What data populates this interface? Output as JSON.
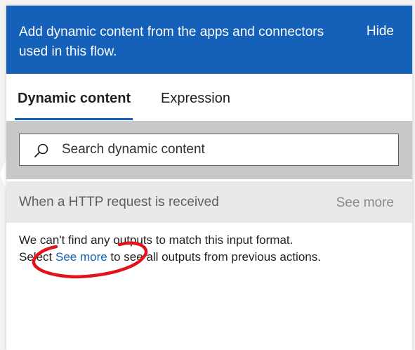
{
  "header": {
    "text": "Add dynamic content from the apps and connectors used in this flow.",
    "hide_label": "Hide"
  },
  "tabs": [
    {
      "label": "Dynamic content",
      "active": true
    },
    {
      "label": "Expression",
      "active": false
    }
  ],
  "search": {
    "placeholder": "Search dynamic content",
    "value": ""
  },
  "section": {
    "title": "When a HTTP request is received",
    "see_more_label": "See more"
  },
  "message": {
    "line1": "We can't find any outputs to match this input format.",
    "line2_before": "Select ",
    "line2_link": "See more",
    "line2_after": " to see all outputs from previous actions."
  },
  "colors": {
    "header_bg": "#1560b8",
    "accent": "#1560b8",
    "search_area_bg": "#c8c8c8",
    "section_bg": "#e9eae8",
    "annotation": "#e3131b"
  },
  "icons": {
    "search": "search-icon"
  }
}
